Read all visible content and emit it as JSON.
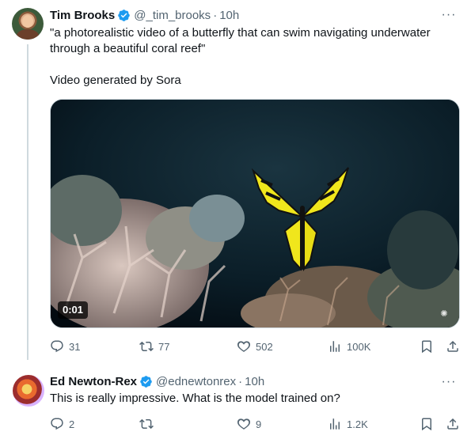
{
  "tweet1": {
    "name": "Tim Brooks",
    "handle": "@_tim_brooks",
    "separator": "·",
    "time": "10h",
    "text_line1": "\"a photorealistic video of a butterfly that can swim navigating underwater through a beautiful coral reef\"",
    "text_line2": "Video generated by Sora",
    "video_timestamp": "0:01",
    "replies": "31",
    "retweets": "77",
    "likes": "502",
    "views": "100K",
    "more_label": "···"
  },
  "tweet2": {
    "name": "Ed Newton-Rex",
    "handle": "@ednewtonrex",
    "separator": "·",
    "time": "10h",
    "text": "This is really impressive. What is the model trained on?",
    "replies": "2",
    "retweets": "",
    "likes": "9",
    "views": "1.2K",
    "more_label": "···"
  },
  "icons": {
    "verified": "verified-badge-icon",
    "reply": "reply-icon",
    "retweet": "retweet-icon",
    "like": "heart-icon",
    "views": "views-icon",
    "bookmark": "bookmark-icon",
    "share": "share-icon",
    "watermark": "watermark-icon"
  },
  "colors": {
    "verified_blue": "#1d9bf0",
    "muted_text": "#536471",
    "primary_text": "#0f1419",
    "thread_line": "#cfd9de"
  }
}
